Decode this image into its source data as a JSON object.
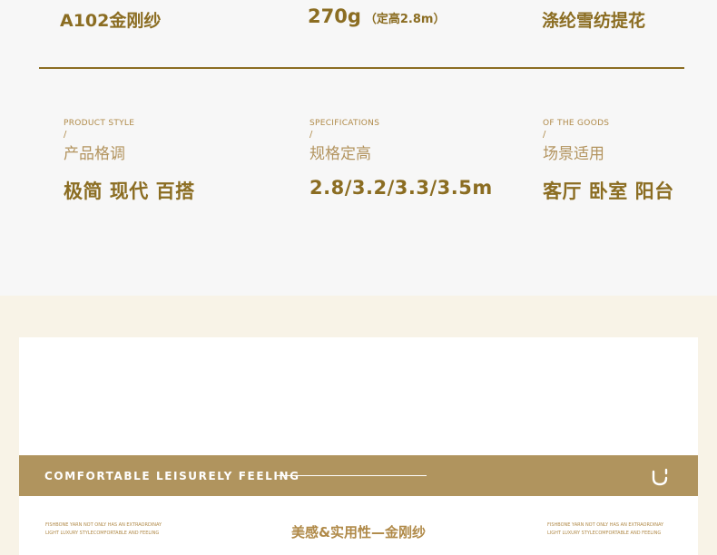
{
  "top": {
    "model": "A102金刚纱",
    "weight_main": "270g",
    "weight_sub": "（定高2.8m）",
    "material": "涤纶雪纺提花"
  },
  "specs": [
    {
      "en": "PRODUCT STYLE",
      "slash": "/",
      "cn": "产品格调",
      "value": "极简 现代 百搭"
    },
    {
      "en": "SPECIFICATIONS",
      "slash": "/",
      "cn": "规格定高",
      "value": "2.8/3.2/3.3/3.5m"
    },
    {
      "en": "OF THE GOODS",
      "slash": "/",
      "cn": "场景适用",
      "value": "客厅 卧室 阳台"
    }
  ],
  "band": {
    "title": "COMFORTABLE LEISURELY FEELING",
    "logo_icon": "u-logo-icon"
  },
  "bottom": {
    "left_line1": "FISHBONE YARN NOT ONLY HAS AN EXTRAORDINAY",
    "left_line2": "LIGHT LUXURY STYLECOMFORTABLE AND  FEELING",
    "center_title": "美感&实用性—金刚纱",
    "right_line1": "FISHBONE YARN NOT ONLY HAS AN EXTRAORDINAY",
    "right_line2": "LIGHT LUXURY STYLECOMFORTABLE AND  FEELING"
  },
  "colors": {
    "gold": "#8b6d22",
    "band": "#b0945e",
    "section_bg": "#f8f3e7"
  }
}
